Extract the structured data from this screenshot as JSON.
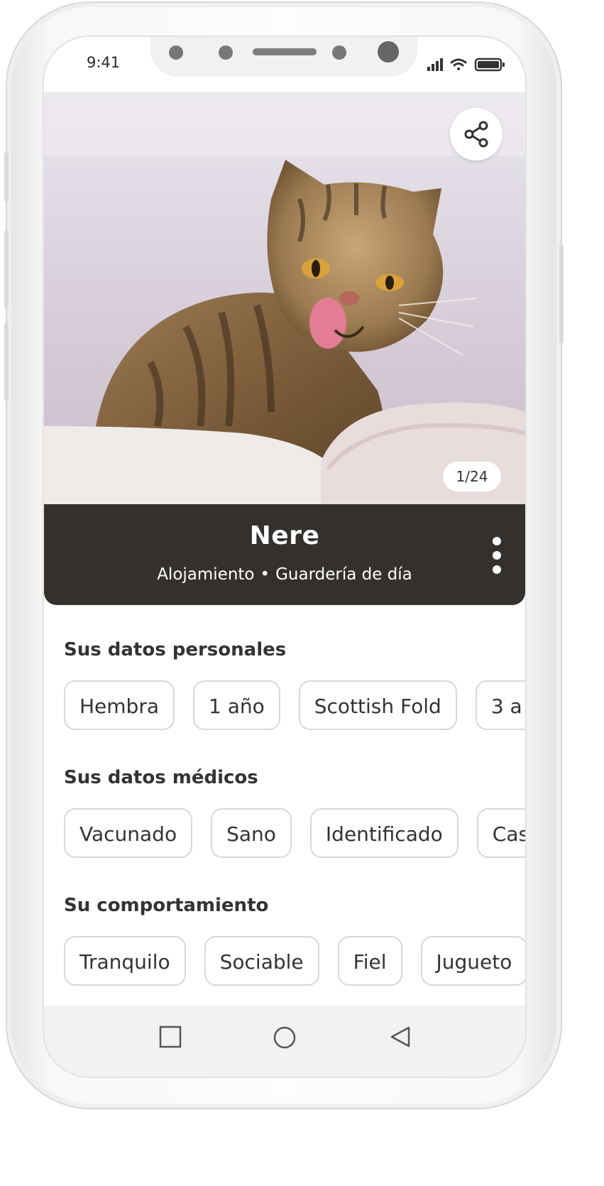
{
  "status_bar": {
    "time": "9:41"
  },
  "pet": {
    "name": "Nere",
    "service_1": "Alojamiento",
    "separator": "•",
    "service_2": "Guardería de día",
    "photo_counter": "1/24"
  },
  "sections": {
    "personal": {
      "title": "Sus datos personales",
      "chips": [
        "Hembra",
        "1 año",
        "Scottish Fold",
        "3 a"
      ]
    },
    "medical": {
      "title": "Sus datos médicos",
      "chips": [
        "Vacunado",
        "Sano",
        "Identificado",
        "Cas"
      ]
    },
    "behavior": {
      "title": "Su comportamiento",
      "chips": [
        "Tranquilo",
        "Sociable",
        "Fiel",
        "Jugueto"
      ]
    }
  },
  "icons": {
    "share": "share-icon",
    "menu": "more-vertical-icon",
    "nav_recent": "square-icon",
    "nav_home": "circle-icon",
    "nav_back": "triangle-back-icon"
  },
  "colors": {
    "namebar_bg": "#33302d",
    "chip_border": "#d9d9d9",
    "text": "#333333"
  }
}
